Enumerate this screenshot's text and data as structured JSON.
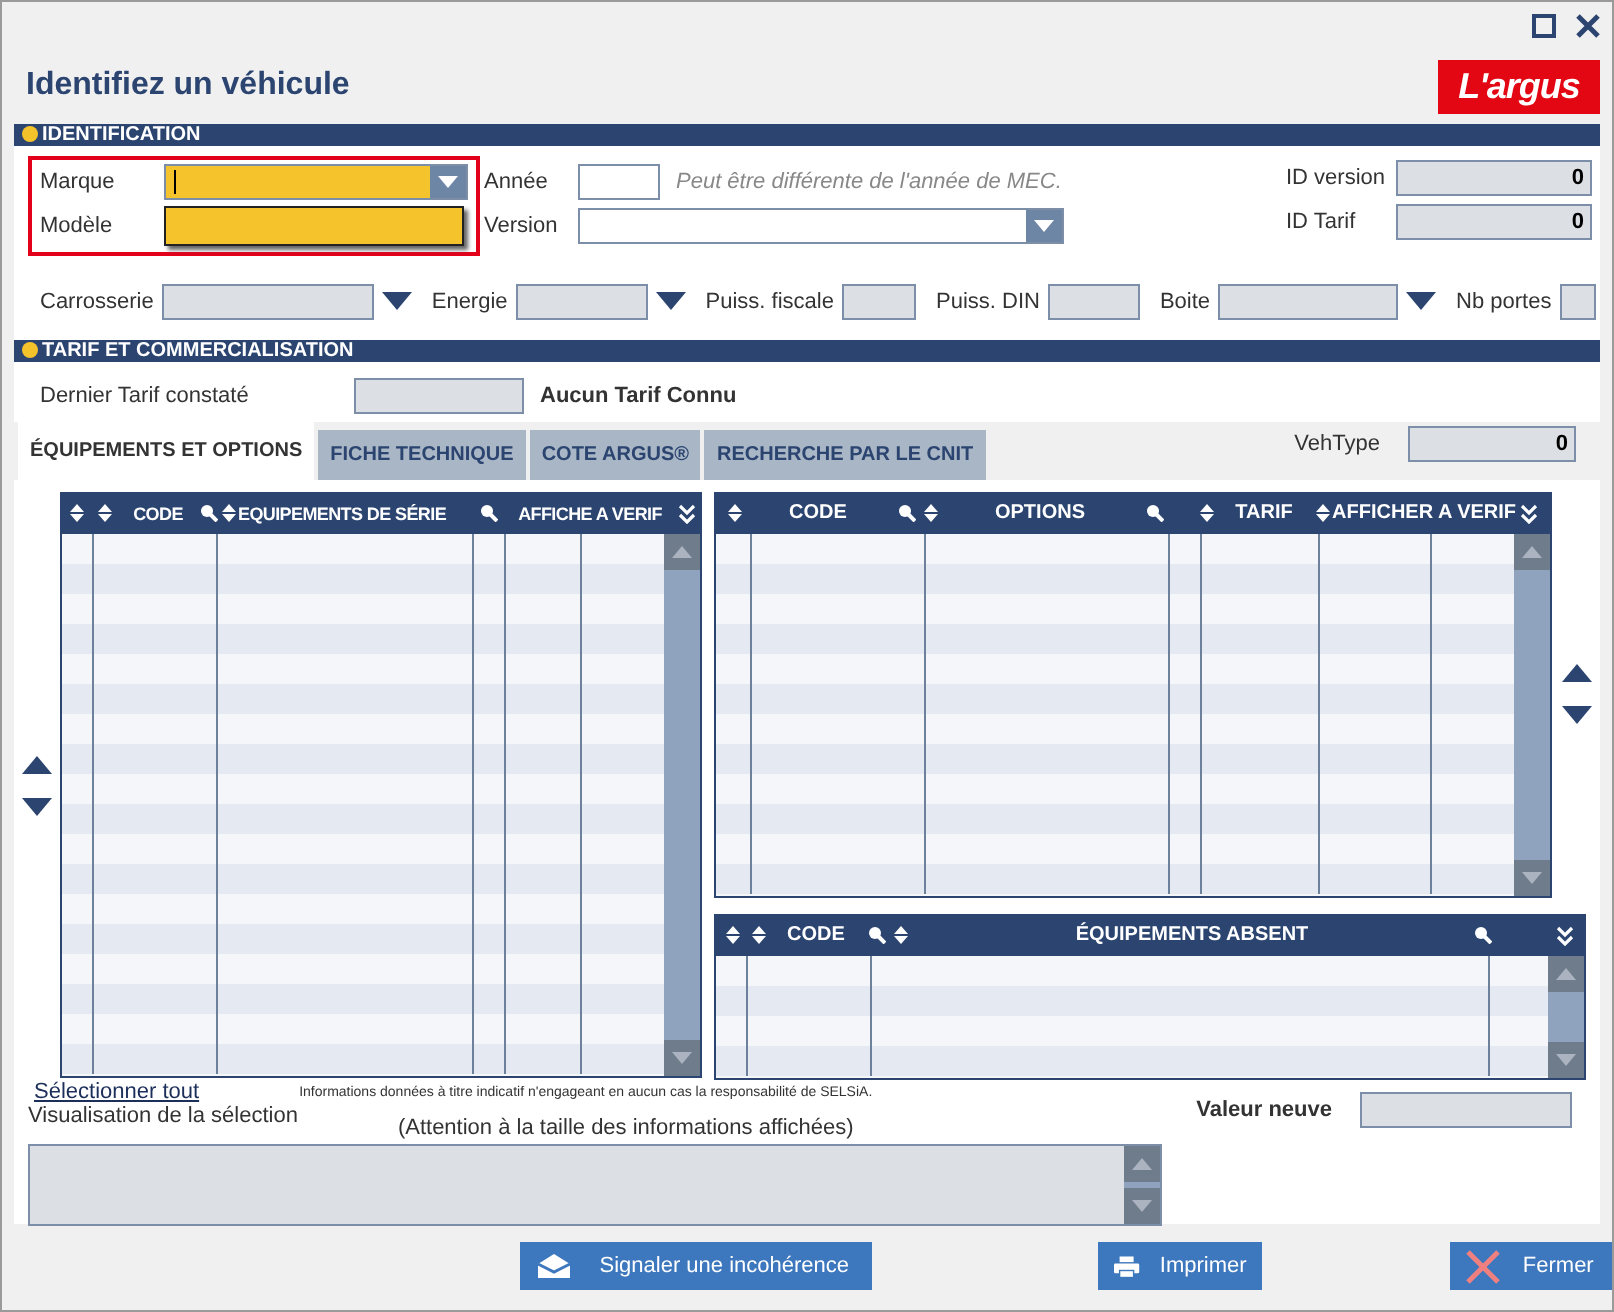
{
  "window": {
    "title": "Identifiez un véhicule",
    "logo": "L'argus"
  },
  "identification": {
    "header": "IDENTIFICATION",
    "highlighted": true,
    "marque": {
      "label": "Marque",
      "focused": true
    },
    "modele": {
      "label": "Modèle",
      "expanded": true
    },
    "annee": {
      "label": "Année",
      "hint": "Peut être différente de l'année de MEC."
    },
    "version": {
      "label": "Version"
    },
    "id_version": {
      "label": "ID version",
      "value": "0"
    },
    "id_tarif": {
      "label": "ID Tarif",
      "value": "0"
    },
    "attributes": [
      {
        "label": "Carrosserie",
        "kind": "combo"
      },
      {
        "label": "Energie",
        "kind": "combo"
      },
      {
        "label": "Puiss. fiscale",
        "kind": "field"
      },
      {
        "label": "Puiss. DIN",
        "kind": "field"
      },
      {
        "label": "Boite",
        "kind": "combo"
      },
      {
        "label": "Nb portes",
        "kind": "field"
      }
    ]
  },
  "tarif": {
    "header": "TARIF ET COMMERCIALISATION",
    "label": "Dernier Tarif constaté",
    "status": "Aucun Tarif Connu"
  },
  "tabs": [
    {
      "label": "ÉQUIPEMENTS ET OPTIONS",
      "selected": true
    },
    {
      "label": "FICHE TECHNIQUE",
      "selected": false
    },
    {
      "label": "COTE ARGUS®",
      "selected": false
    },
    {
      "label": "RECHERCHE PAR LE CNIT",
      "selected": false
    }
  ],
  "vehtype": {
    "label": "VehType",
    "value": "0"
  },
  "tables": [
    {
      "columns": [
        "CODE",
        "EQUIPEMENTS DE SÉRIE",
        "AFFICHE A VERIF"
      ]
    },
    {
      "columns": [
        "CODE",
        "OPTIONS",
        "TARIF",
        "AFFICHER A VERIF"
      ]
    },
    {
      "columns": [
        "CODE",
        "ÉQUIPEMENTS ABSENT"
      ]
    }
  ],
  "select_all": "Sélectionner tout",
  "disclaimer": "Informations données à titre indicatif n'engageant en aucun cas la responsabilité de SELSiA.",
  "selection": {
    "label": "Visualisation de la sélection",
    "note": "(Attention à la taille des informations affichées)"
  },
  "valeur_neuve": {
    "label": "Valeur neuve"
  },
  "buttons": [
    {
      "label": "Signaler une incohérence",
      "kind": "report"
    },
    {
      "label": "Imprimer",
      "kind": "print"
    },
    {
      "label": "Fermer",
      "kind": "close"
    }
  ]
}
